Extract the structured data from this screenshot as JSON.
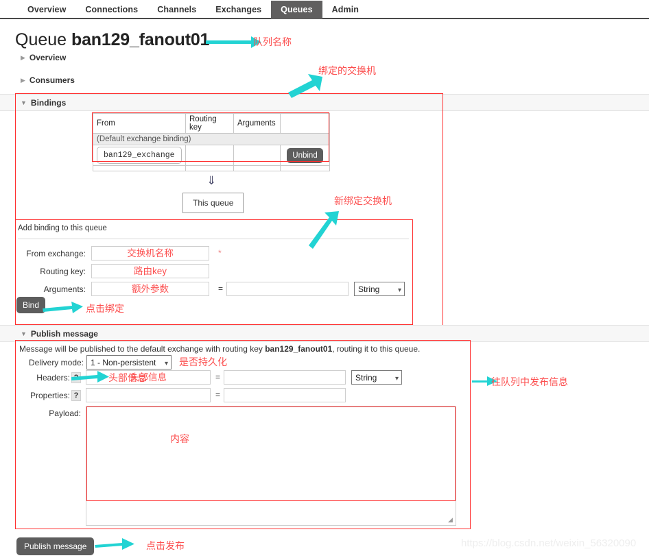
{
  "nav": {
    "tabs": [
      {
        "label": "Overview",
        "active": false
      },
      {
        "label": "Connections",
        "active": false
      },
      {
        "label": "Channels",
        "active": false
      },
      {
        "label": "Exchanges",
        "active": false
      },
      {
        "label": "Queues",
        "active": true
      },
      {
        "label": "Admin",
        "active": false
      }
    ]
  },
  "page": {
    "title_prefix": "Queue",
    "queue_name": "ban129_fanout01"
  },
  "sections": {
    "overview_label": "Overview",
    "consumers_label": "Consumers",
    "bindings_label": "Bindings",
    "publish_label": "Publish message",
    "collapsed_icon": "▶",
    "expanded_icon": "▼"
  },
  "bindings": {
    "table": {
      "headers": [
        "From",
        "Routing key",
        "Arguments",
        ""
      ],
      "default_row": "(Default exchange binding)",
      "rows": [
        {
          "from": "ban129_exchange",
          "routing_key": "",
          "arguments": "",
          "action": "Unbind"
        }
      ]
    },
    "flow_arrow": "⇓",
    "this_queue_label": "This queue",
    "form": {
      "legend": "Add binding to this queue",
      "fields": [
        {
          "label": "From exchange:",
          "value": "交换机名称",
          "required_mark": "*"
        },
        {
          "label": "Routing key:",
          "value": "路由key",
          "required_mark": ""
        },
        {
          "label": "Arguments:",
          "value": "额外参数",
          "required_mark": ""
        }
      ],
      "equals": "=",
      "arg_value": "",
      "type_select": "String",
      "submit_label": "Bind"
    }
  },
  "publish": {
    "message_note_prefix": "Message will be published to the default exchange with routing key ",
    "message_note_key": "ban129_fanout01",
    "message_note_suffix": ", routing it to this queue.",
    "delivery_mode_label": "Delivery mode:",
    "delivery_mode_value": "1 - Non-persistent",
    "headers_label": "Headers:",
    "headers_help": "?",
    "headers_key": "头部信息",
    "headers_value": "",
    "headers_type": "String",
    "properties_label": "Properties:",
    "properties_help": "?",
    "properties_key": "",
    "properties_value": "",
    "equals": "=",
    "payload_label": "Payload:",
    "payload_value": "",
    "payload_annotation": "内容",
    "submit_label": "Publish message"
  },
  "annotations": {
    "queue_name": "队列名称",
    "bound_exchange": "绑定的交换机",
    "new_binding_exchange": "新绑定交换机",
    "click_bind": "点击绑定",
    "persist_or_not": "是否持久化",
    "publish_to_queue": "往队列中发布信息",
    "click_publish": "点击发布"
  },
  "watermark": "https://blog.csdn.net/weixin_56320090",
  "colors": {
    "annotation_red": "#fc4f4f",
    "annotation_arrow_teal": "#22d3d3",
    "active_tab_bg": "#605f5f",
    "button_gray": "#5d5d5d"
  }
}
